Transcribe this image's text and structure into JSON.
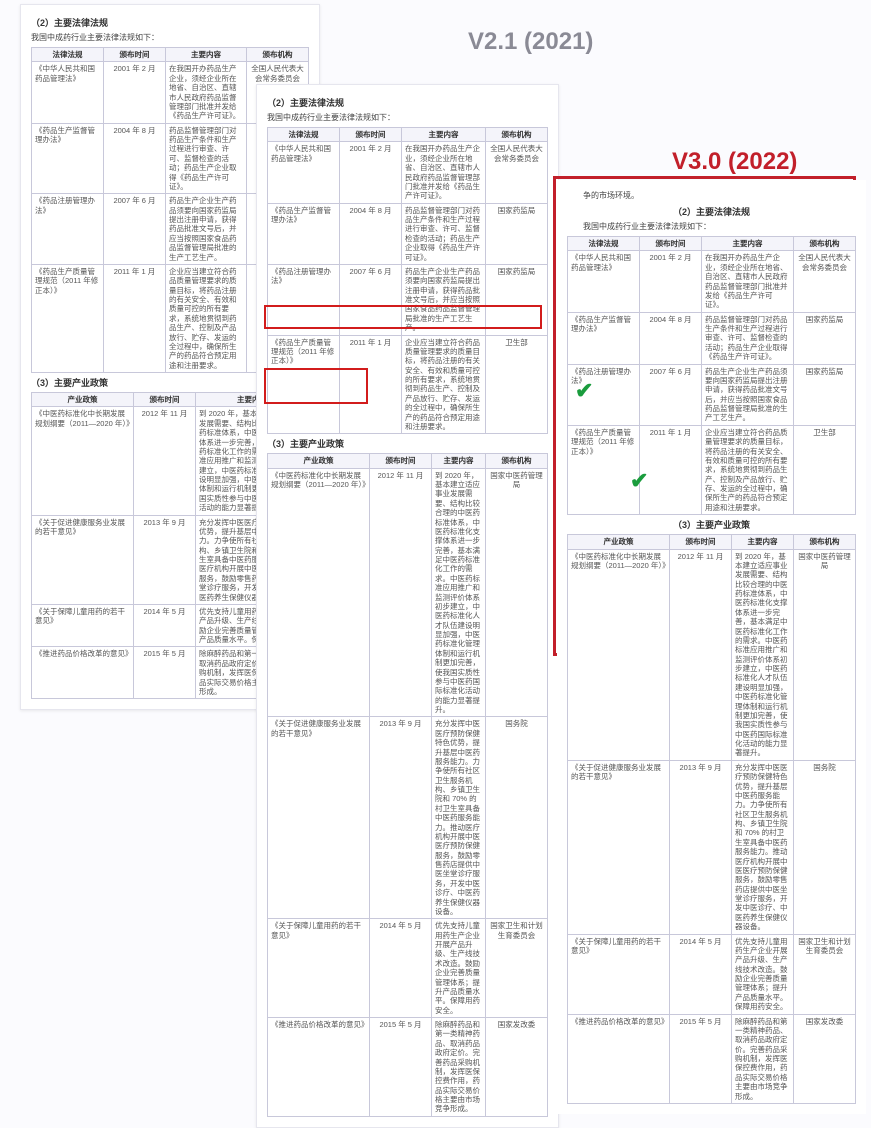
{
  "labels": {
    "v21": "V2.1 (2021)",
    "v30": "V3.0 (2022)"
  },
  "section_law_title": "（2）主要法律法规",
  "section_law_sub": "我国中成药行业主要法律法规如下：",
  "section_pol_title": "（3）主要产业政策",
  "law_headers": [
    "法律法规",
    "颁布时间",
    "主要内容",
    "颁布机构"
  ],
  "pol_headers": [
    "产业政策",
    "颁布时间",
    "主要内容",
    "颁布机构"
  ],
  "law_rows": [
    {
      "name": "《中华人民共和国药品管理法》",
      "date": "2001 年 2 月",
      "body": "在我国开办药品生产企业，须经企业所在地省、自治区、直辖市人民政府药品监督管理部门批准并发给《药品生产许可证》。",
      "org": "全国人民代表大会常务委员会"
    },
    {
      "name": "《药品生产监督管理办法》",
      "date": "2004 年 8 月",
      "body": "药品监督管理部门对药品生产条件和生产过程进行审查、许可、监督检查的活动；药品生产企业取得《药品生产许可证》。",
      "org": "国家药监局"
    },
    {
      "name": "《药品注册管理办法》",
      "date": "2007 年 6 月",
      "body": "药品生产企业生产药品须要向国家药监局提出注册申请，获得药品批准文号后，并应当按照国家食品药品监督管理局批准的生产工艺生产。",
      "org": "国家药监局"
    },
    {
      "name": "《药品生产质量管理规范（2011 年修正本）》",
      "date": "2011 年 1 月",
      "body": "企业应当建立符合药品质量管理要求的质量目标，将药品注册的有关安全、有效和质量可控的所有要求，系统地贯彻到药品生产、控制及产品放行、贮存、发运的全过程中，确保所生产的药品符合预定用途和注册要求。",
      "org": "卫生部"
    }
  ],
  "pol_rows": [
    {
      "name": "《中医药标准化中长期发展规划纲要（2011—2020 年）》",
      "date": "2012 年 11 月",
      "body": "到 2020 年，基本建立适应事业发展需要、结构比较合理的中医药标准体系，中医药标准化支撑体系进一步完善，基本满足中医药标准化工作的需求。中医药标准应用推广和监测评价体系初步建立，中医药标准化人才队伍建设明显加强，中医药标准化管理体制和运行机制更加完善，使我国实质性参与中医药国际标准化活动的能力显著提升。",
      "org": "国家中医药管理局"
    },
    {
      "name": "《关于促进健康服务业发展的若干意见》",
      "date": "2013 年 9 月",
      "body": "充分发挥中医医疗预防保健特色优势，提升基层中医药服务能力。力争使所有社区卫生服务机构、乡镇卫生院和 70% 的村卫生室具备中医药服务能力。推动医疗机构开展中医医疗预防保健服务，鼓励零售药店提供中医坐堂诊疗服务，开发中医诊疗、中医药养生保健仪器设备。",
      "org": "国务院"
    },
    {
      "name": "《关于保障儿童用药的若干意见》",
      "date": "2014 年 5 月",
      "body": "优先支持儿童用药生产企业开展产品升级、生产线技术改造。鼓励企业完善质量管理体系；提升产品质量水平。保障用药安全。",
      "org": "国家卫生和计划生育委员会"
    },
    {
      "name": "《推进药品价格改革的意见》",
      "date": "2015 年 5 月",
      "body": "除麻醉药品和第一类精神药品、取消药品政府定价。完善药品采购机制，发挥医保控费作用，药品实际交易价格主要由市场竞争形成。",
      "org": "国家发改委"
    }
  ],
  "v30_top_line": "争的市场环境。"
}
